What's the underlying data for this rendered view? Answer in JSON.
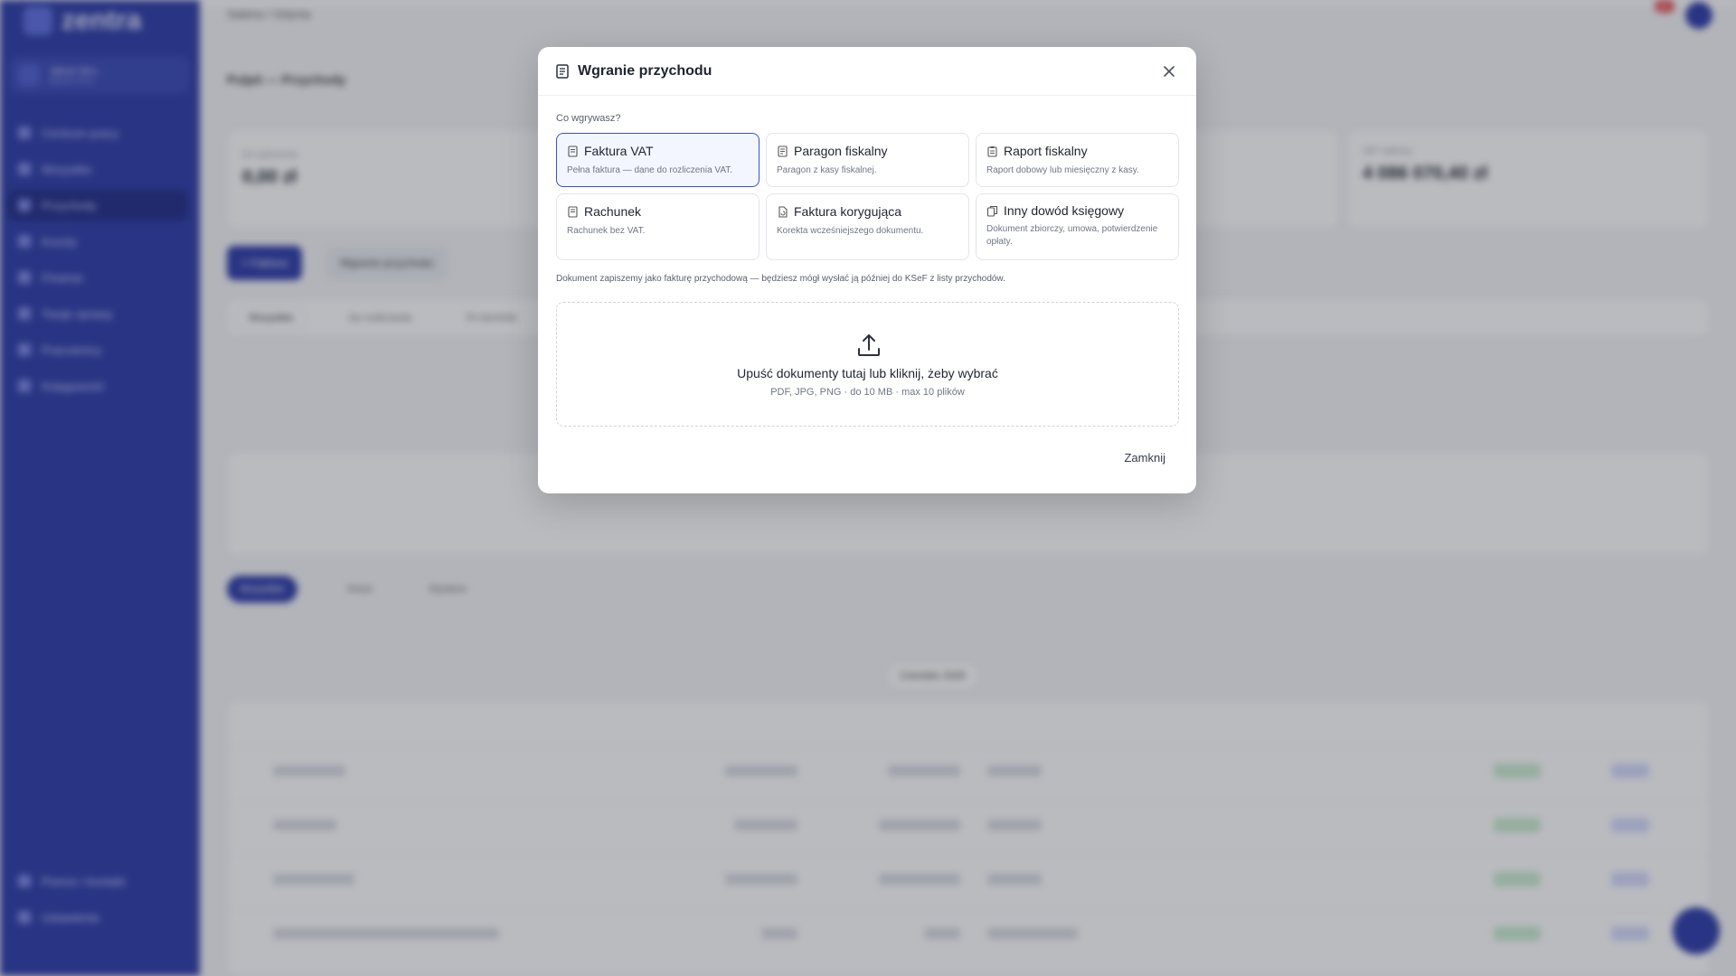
{
  "app": {
    "brand": "zentra",
    "top_breadcrumb": "Sabina / Gdynia",
    "notification_count": "9+",
    "company": {
      "name": "Jakub Stro...",
      "sub": "aktywna firma"
    },
    "nav": [
      "Centrum pracy",
      "Wszystko",
      "Przychody",
      "Koszty",
      "Finanse",
      "Twoje sprawy",
      "Pracownicy",
      "Księgowość"
    ],
    "nav_bottom": [
      "Pomoc i kontakt",
      "Ustawienia"
    ],
    "page_title": "Pulpit — Przychody",
    "stat_left": {
      "label": "Do wyliczenia",
      "value": "0,00 zł"
    },
    "stat_right": {
      "label": "VAT należny",
      "value": "4 086 070,40 zł"
    },
    "action_primary": "+ Faktura",
    "action_secondary": "Wgranie przychodu",
    "tabs": [
      "Wszystkie",
      "Do rozliczenia",
      "Po terminie"
    ],
    "list_tabs": [
      "Wszystkie",
      "Nowe",
      "Wysłane"
    ],
    "month_label": "Czerwiec 2026"
  },
  "modal": {
    "title": "Wgranie przychodu",
    "ask": "Co wgrywasz?",
    "options": [
      {
        "title": "Faktura VAT",
        "desc": "Pełna faktura — dane do rozliczenia VAT."
      },
      {
        "title": "Paragon fiskalny",
        "desc": "Paragon z kasy fiskalnej."
      },
      {
        "title": "Raport fiskalny",
        "desc": "Raport dobowy lub miesięczny z kasy."
      },
      {
        "title": "Rachunek",
        "desc": "Rachunek bez VAT."
      },
      {
        "title": "Faktura korygująca",
        "desc": "Korekta wcześniejszego dokumentu."
      },
      {
        "title": "Inny dowód księgowy",
        "desc": "Dokument zbiorczy, umowa, potwierdzenie opłaty."
      }
    ],
    "selected_option": "Faktura VAT",
    "note": "Dokument zapiszemy jako fakturę przychodową — będziesz mógł wysłać ją później do KSeF z listy przychodów.",
    "drop_main": "Upuść dokumenty tutaj lub kliknij, żeby wybrać",
    "drop_sub": "PDF, JPG, PNG · do 10 MB · max 10 plików",
    "close_label": "Zamknij"
  },
  "colors": {
    "accent": "#3b4fd0",
    "sidebar": "#2a3aa8"
  }
}
